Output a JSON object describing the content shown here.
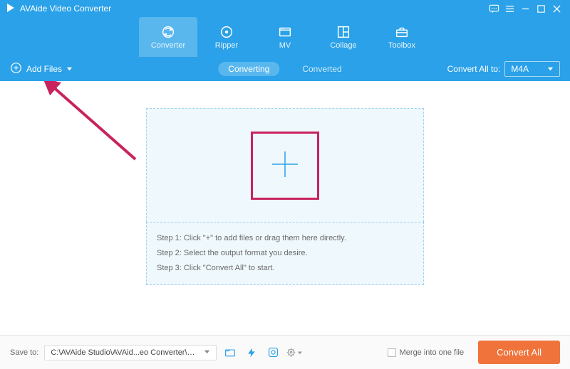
{
  "app": {
    "title": "AVAide Video Converter"
  },
  "tabs": [
    {
      "label": "Converter"
    },
    {
      "label": "Ripper"
    },
    {
      "label": "MV"
    },
    {
      "label": "Collage"
    },
    {
      "label": "Toolbox"
    }
  ],
  "subbar": {
    "addFiles": "Add Files",
    "pillActive": "Converting",
    "pillInactive": "Converted",
    "convertAllTo": "Convert All to:",
    "format": "M4A"
  },
  "dropzone": {
    "step1": "Step 1: Click \"+\" to add files or drag them here directly.",
    "step2": "Step 2: Select the output format you desire.",
    "step3": "Step 3: Click \"Convert All\" to start."
  },
  "bottom": {
    "saveTo": "Save to:",
    "path": "C:\\AVAide Studio\\AVAid...eo Converter\\Converted",
    "merge": "Merge into one file",
    "convertAll": "Convert All"
  }
}
